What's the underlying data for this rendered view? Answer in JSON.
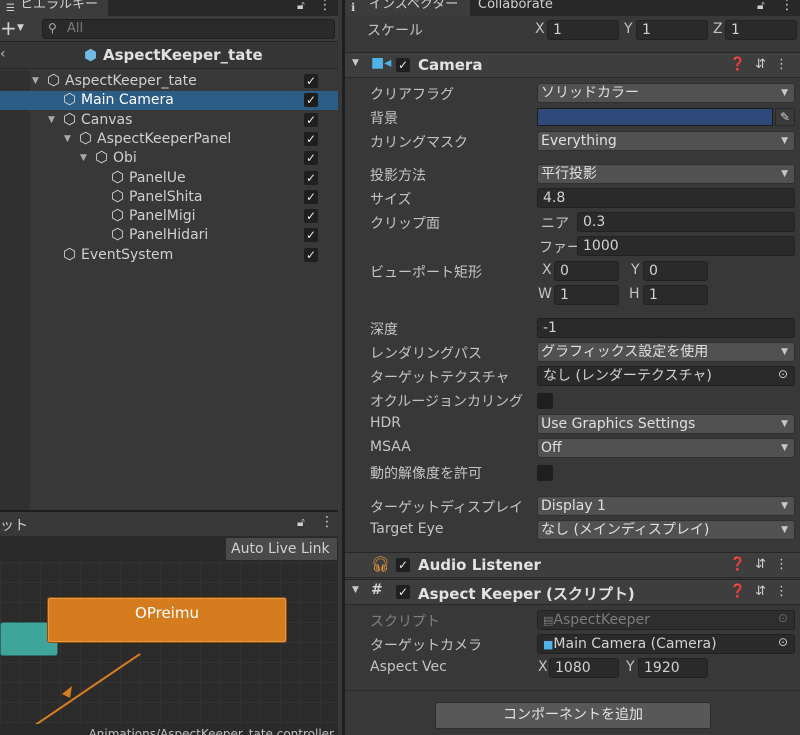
{
  "hierarchy": {
    "tab_label": "ヒエラルキー",
    "add_icon": "+",
    "search_placeholder": "All",
    "scene_name": "AspectKeeper_tate",
    "items": [
      {
        "label": "AspectKeeper_tate",
        "selected": false,
        "expanded": true
      },
      {
        "label": "Main Camera",
        "selected": true
      },
      {
        "label": "Canvas",
        "selected": false,
        "expanded": true
      },
      {
        "label": "AspectKeeperPanel",
        "selected": false,
        "expanded": true
      },
      {
        "label": "Obi",
        "selected": false,
        "expanded": true
      },
      {
        "label": "PanelUe",
        "selected": false
      },
      {
        "label": "PanelShita",
        "selected": false
      },
      {
        "label": "PanelMigi",
        "selected": false
      },
      {
        "label": "PanelHidari",
        "selected": false
      },
      {
        "label": "EventSystem",
        "selected": false
      }
    ]
  },
  "animator": {
    "tab_label": "ット",
    "auto_live_link": "Auto Live Link",
    "state_label": "OPreimu",
    "path": "Animations/AspectKeeper_tate.controller"
  },
  "inspector": {
    "tab_label": "インスペクター",
    "collab_tab": "Collaborate",
    "scale": {
      "label": "スケール",
      "x": "1",
      "y": "1",
      "z": "1",
      "xl": "X",
      "yl": "Y",
      "zl": "Z"
    },
    "camera": {
      "title": "Camera",
      "clear_flags": {
        "label": "クリアフラグ",
        "value": "ソリッドカラー"
      },
      "background": {
        "label": "背景",
        "color": "#2f4a7a"
      },
      "culling": {
        "label": "カリングマスク",
        "value": "Everything"
      },
      "projection": {
        "label": "投影方法",
        "value": "平行投影"
      },
      "size": {
        "label": "サイズ",
        "value": "4.8"
      },
      "clip": {
        "label": "クリップ面",
        "near_label": "ニア",
        "near": "0.3",
        "far_label": "ファー",
        "far": "1000"
      },
      "viewport": {
        "label": "ビューポート矩形",
        "x": "0",
        "y": "0",
        "w": "1",
        "h": "1",
        "xl": "X",
        "yl": "Y",
        "wl": "W",
        "hl": "H"
      },
      "depth": {
        "label": "深度",
        "value": "-1"
      },
      "rendering": {
        "label": "レンダリングパス",
        "value": "グラフィックス設定を使用"
      },
      "target_texture": {
        "label": "ターゲットテクスチャ",
        "value": "なし (レンダーテクスチャ)"
      },
      "occlusion": {
        "label": "オクルージョンカリング"
      },
      "hdr": {
        "label": "HDR",
        "value": "Use Graphics Settings"
      },
      "msaa": {
        "label": "MSAA",
        "value": "Off"
      },
      "dynamic_res": {
        "label": "動的解像度を許可"
      },
      "target_display": {
        "label": "ターゲットディスプレイ",
        "value": "Display 1"
      },
      "target_eye": {
        "label": "Target Eye",
        "value": "なし (メインディスプレイ)"
      }
    },
    "audio_listener": {
      "title": "Audio Listener"
    },
    "aspect_keeper": {
      "title": "Aspect Keeper (スクリプト)",
      "script": {
        "label": "スクリプト",
        "value": "AspectKeeper"
      },
      "target_camera": {
        "label": "ターゲットカメラ",
        "value": "Main Camera (Camera)"
      },
      "aspect_vec": {
        "label": "Aspect Vec",
        "xl": "X",
        "x": "1080",
        "yl": "Y",
        "y": "1920"
      }
    },
    "add_component": "コンポーネントを追加"
  },
  "colors": {
    "selection": "#2c5d87",
    "state_orange": "#d57d1e",
    "accent_green": "#3fa59b"
  }
}
